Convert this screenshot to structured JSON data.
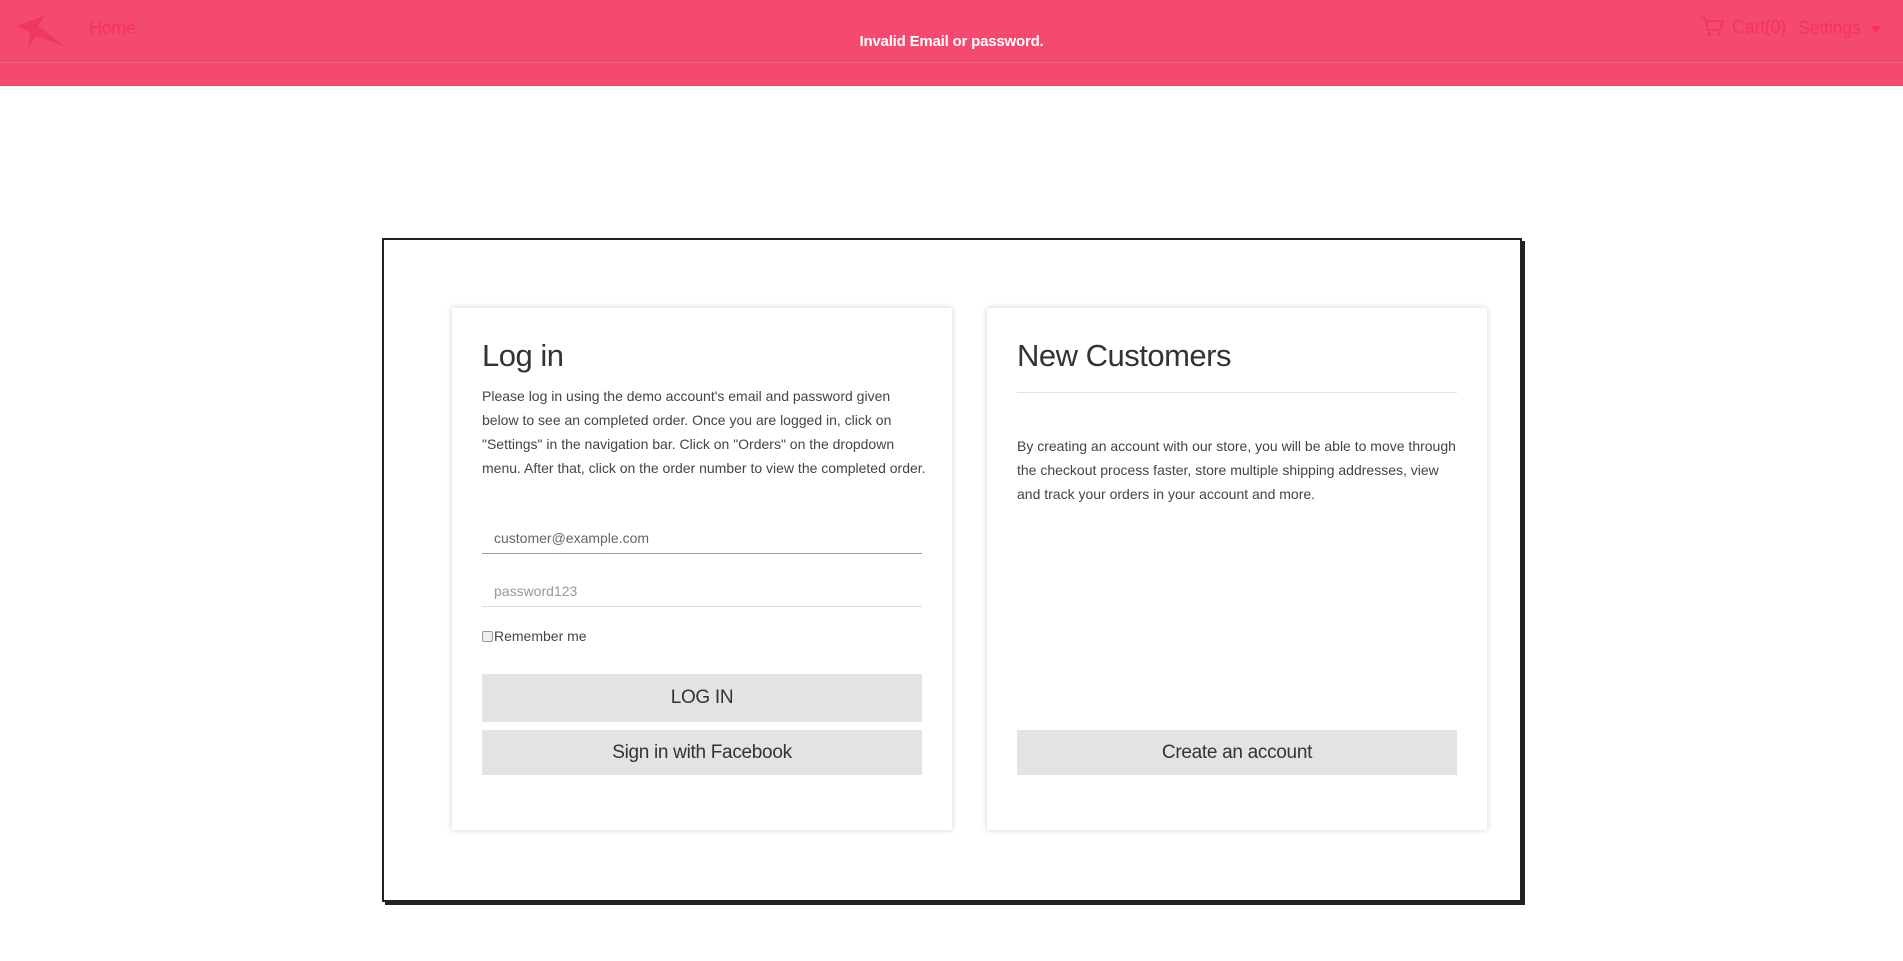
{
  "nav": {
    "home_label": "Home",
    "cart_label": "Cart(0)",
    "settings_label": "Settings"
  },
  "flash": {
    "message": "Invalid Email or password."
  },
  "login": {
    "title": "Log in",
    "description": "Please log in using the demo account's email and password given below to see an completed order. Once you are logged in, click on \"Settings\" in the navigation bar. Click on \"Orders\" on the dropdown menu. After that, click on the order number to view the completed order.",
    "email_value": "customer@example.com",
    "password_placeholder": "password123",
    "remember_label": "Remember me",
    "login_button": "LOG IN",
    "facebook_button": "Sign in with Facebook"
  },
  "new_customers": {
    "title": "New Customers",
    "description": "By creating an account with our store, you will be able to move through the checkout process faster, store multiple shipping addresses, view and track your orders in your account and more.",
    "create_button": "Create an account"
  },
  "colors": {
    "accent": "#e31b3a",
    "flash_bg": "#f43661",
    "button_bg": "#e3e3e3",
    "focus_border": "#5ab4e8"
  }
}
